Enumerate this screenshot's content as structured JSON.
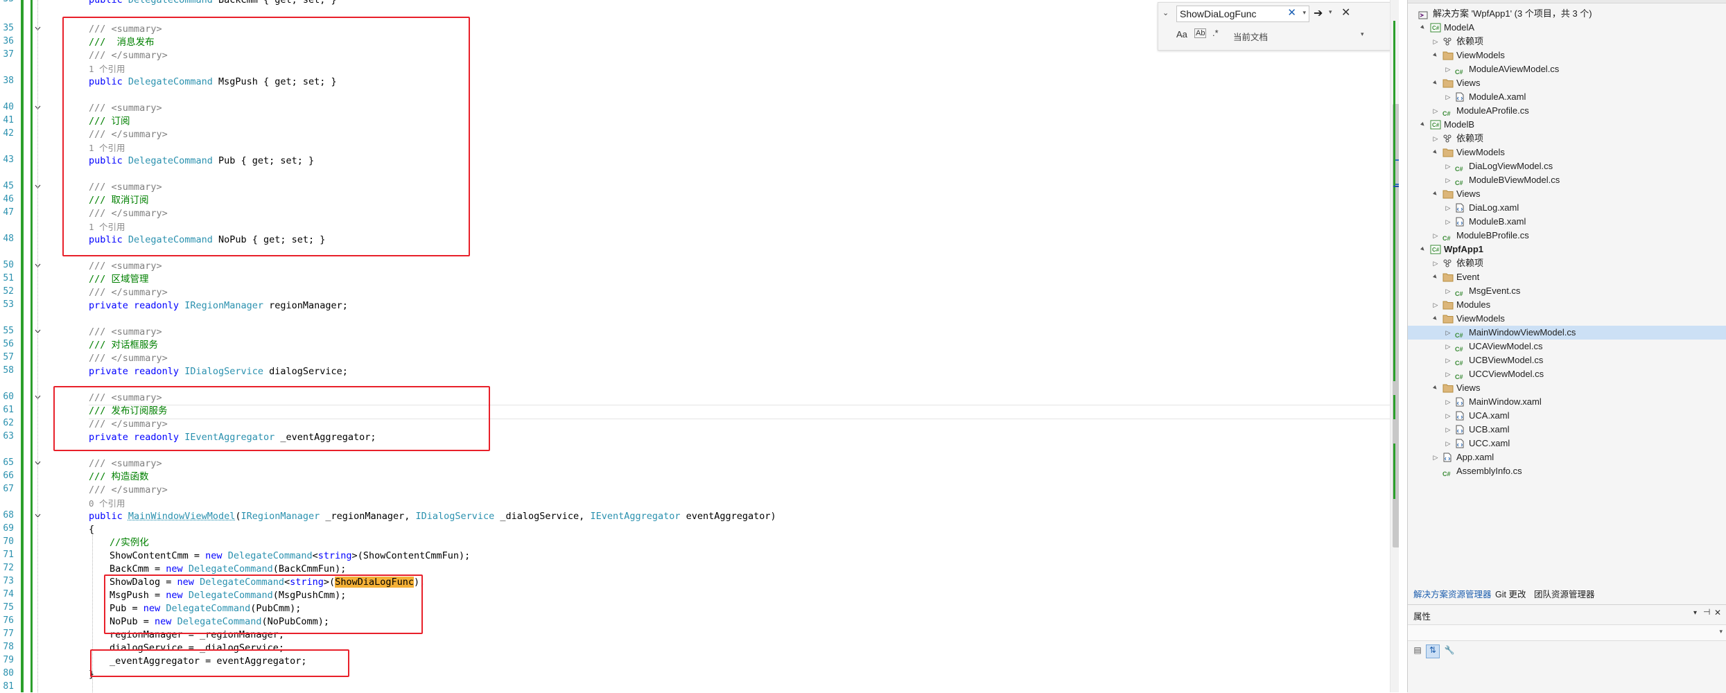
{
  "editor": {
    "line_numbers": [
      "33",
      "35",
      "36",
      "37",
      "",
      "38",
      "",
      "40",
      "41",
      "42",
      "",
      "43",
      "",
      "45",
      "46",
      "47",
      "",
      "48",
      "",
      "50",
      "51",
      "52",
      "53",
      "",
      "55",
      "56",
      "57",
      "58",
      "",
      "60",
      "61",
      "62",
      "63",
      "",
      "65",
      "66",
      "67",
      "",
      "68",
      "69",
      "70",
      "71",
      "72",
      "73",
      "74",
      "75",
      "76",
      "77",
      "78",
      "79",
      "80",
      "81"
    ],
    "code": {
      "l33": "public DelegateCommand BackCmm { get; set; }",
      "l35": "/// <summary>",
      "l36": "///  消息发布",
      "l37": "/// </summary>",
      "ref1": "1 个引用",
      "l38_kw": "public",
      "l38_ty": "DelegateCommand",
      "l38_rest": " MsgPush { get; set; }",
      "l40": "/// <summary>",
      "l41": "/// 订阅",
      "l42": "/// </summary>",
      "ref2": "1 个引用",
      "l43_rest": " Pub { get; set; }",
      "l45": "/// <summary>",
      "l46": "/// 取消订阅",
      "l47": "/// </summary>",
      "ref3": "1 个引用",
      "l48_rest": " NoPub { get; set; }",
      "l50": "/// <summary>",
      "l51": "/// 区域管理",
      "l52": "/// </summary>",
      "l53_kw": "private readonly",
      "l53_ty": "IRegionManager",
      "l53_rest": " regionManager;",
      "l55": "/// <summary>",
      "l56": "/// 对话框服务",
      "l57": "/// </summary>",
      "l58_ty": "IDialogService",
      "l58_rest": " dialogService;",
      "l60": "/// <summary>",
      "l61": "/// 发布订阅服务",
      "l62": "/// </summary>",
      "l63_ty": "IEventAggregator",
      "l63_rest": " _eventAggregator;",
      "l65": "/// <summary>",
      "l66": "/// 构造函数",
      "l67": "/// </summary>",
      "ref0": "0 个引用",
      "l68_kw": "public",
      "l68_name": "MainWindowViewModel",
      "l68_p1t": "IRegionManager",
      "l68_p1": " _regionManager, ",
      "l68_p2t": "IDialogService",
      "l68_p2": " _dialogService, ",
      "l68_p3t": "IEventAggregator",
      "l68_p3": " eventAggregator)",
      "l69": "{",
      "l70": "//实例化",
      "l71_a": "ShowContentCmm = ",
      "l71_b": "new",
      "l71_c": "DelegateCommand",
      "l71_d": "string",
      "l71_e": "(ShowContentCmmFun);",
      "l72_a": "BackCmm = ",
      "l72_e": "(BackCmmFun);",
      "l73_a": "ShowDalog = ",
      "l73_hl": "ShowDiaLogFunc",
      "l73_e": ");",
      "l74_a": "MsgPush = ",
      "l74_e": "(MsgPushCmm);",
      "l75_a": "Pub = ",
      "l75_e": "(PubCmm);",
      "l76_a": "NoPub = ",
      "l76_e": "(NoPubComm);",
      "l77": "regionManager = _regionManager;",
      "l78": "dialogService = _dialogService;",
      "l79": "_eventAggregator = eventAggregator;",
      "l80": "}"
    }
  },
  "find": {
    "query": "ShowDiaLogFunc",
    "scope": "当前文档",
    "opt_case": "Aa",
    "opt_word": "Ab",
    "opt_regex": ".*"
  },
  "solution": {
    "header": "解决方案 'WpfApp1' (3 个项目，共 3 个)",
    "items": [
      {
        "label": "ModelA",
        "indent": 0,
        "icon": "project",
        "tw": "▲"
      },
      {
        "label": "依赖项",
        "indent": 1,
        "icon": "deps",
        "tw": "▷"
      },
      {
        "label": "ViewModels",
        "indent": 1,
        "icon": "folder",
        "tw": "▲"
      },
      {
        "label": "ModuleAViewModel.cs",
        "indent": 2,
        "icon": "cs",
        "tw": "▷"
      },
      {
        "label": "Views",
        "indent": 1,
        "icon": "folder",
        "tw": "▲"
      },
      {
        "label": "ModuleA.xaml",
        "indent": 2,
        "icon": "xaml",
        "tw": "▷"
      },
      {
        "label": "ModuleAProfile.cs",
        "indent": 1,
        "icon": "cs",
        "tw": "▷"
      },
      {
        "label": "ModelB",
        "indent": 0,
        "icon": "project",
        "tw": "▲"
      },
      {
        "label": "依赖项",
        "indent": 1,
        "icon": "deps",
        "tw": "▷"
      },
      {
        "label": "ViewModels",
        "indent": 1,
        "icon": "folder",
        "tw": "▲"
      },
      {
        "label": "DiaLogViewModel.cs",
        "indent": 2,
        "icon": "cs",
        "tw": "▷"
      },
      {
        "label": "ModuleBViewModel.cs",
        "indent": 2,
        "icon": "cs",
        "tw": "▷"
      },
      {
        "label": "Views",
        "indent": 1,
        "icon": "folder",
        "tw": "▲"
      },
      {
        "label": "DiaLog.xaml",
        "indent": 2,
        "icon": "xaml",
        "tw": "▷"
      },
      {
        "label": "ModuleB.xaml",
        "indent": 2,
        "icon": "xaml",
        "tw": "▷"
      },
      {
        "label": "ModuleBProfile.cs",
        "indent": 1,
        "icon": "cs",
        "tw": "▷"
      },
      {
        "label": "WpfApp1",
        "indent": 0,
        "icon": "project",
        "tw": "▲",
        "bold": true
      },
      {
        "label": "依赖项",
        "indent": 1,
        "icon": "deps",
        "tw": "▷"
      },
      {
        "label": "Event",
        "indent": 1,
        "icon": "folder",
        "tw": "▲"
      },
      {
        "label": "MsgEvent.cs",
        "indent": 2,
        "icon": "cs",
        "tw": "▷"
      },
      {
        "label": "Modules",
        "indent": 1,
        "icon": "folder",
        "tw": "▷"
      },
      {
        "label": "ViewModels",
        "indent": 1,
        "icon": "folder",
        "tw": "▲"
      },
      {
        "label": "MainWindowViewModel.cs",
        "indent": 2,
        "icon": "cs",
        "tw": "▷",
        "selected": true
      },
      {
        "label": "UCAViewModel.cs",
        "indent": 2,
        "icon": "cs",
        "tw": "▷"
      },
      {
        "label": "UCBViewModel.cs",
        "indent": 2,
        "icon": "cs",
        "tw": "▷"
      },
      {
        "label": "UCCViewModel.cs",
        "indent": 2,
        "icon": "cs",
        "tw": "▷"
      },
      {
        "label": "Views",
        "indent": 1,
        "icon": "folder",
        "tw": "▲"
      },
      {
        "label": "MainWindow.xaml",
        "indent": 2,
        "icon": "xaml",
        "tw": "▷"
      },
      {
        "label": "UCA.xaml",
        "indent": 2,
        "icon": "xaml",
        "tw": "▷"
      },
      {
        "label": "UCB.xaml",
        "indent": 2,
        "icon": "xaml",
        "tw": "▷"
      },
      {
        "label": "UCC.xaml",
        "indent": 2,
        "icon": "xaml",
        "tw": "▷"
      },
      {
        "label": "App.xaml",
        "indent": 1,
        "icon": "xaml",
        "tw": "▷"
      },
      {
        "label": "AssemblyInfo.cs",
        "indent": 1,
        "icon": "cs",
        "tw": ""
      }
    ],
    "tabs": [
      "解决方案资源管理器",
      "Git 更改",
      "团队资源管理器"
    ]
  },
  "properties": {
    "title": "属性",
    "pin": "▾",
    "close": "✕"
  },
  "colors": {
    "keyword": "#0000ff",
    "type": "#2b91af",
    "comment": "#008000",
    "annotation_box": "#e8202a",
    "change_bar": "#2c9f2c",
    "find_highlight": "#f4b036"
  }
}
